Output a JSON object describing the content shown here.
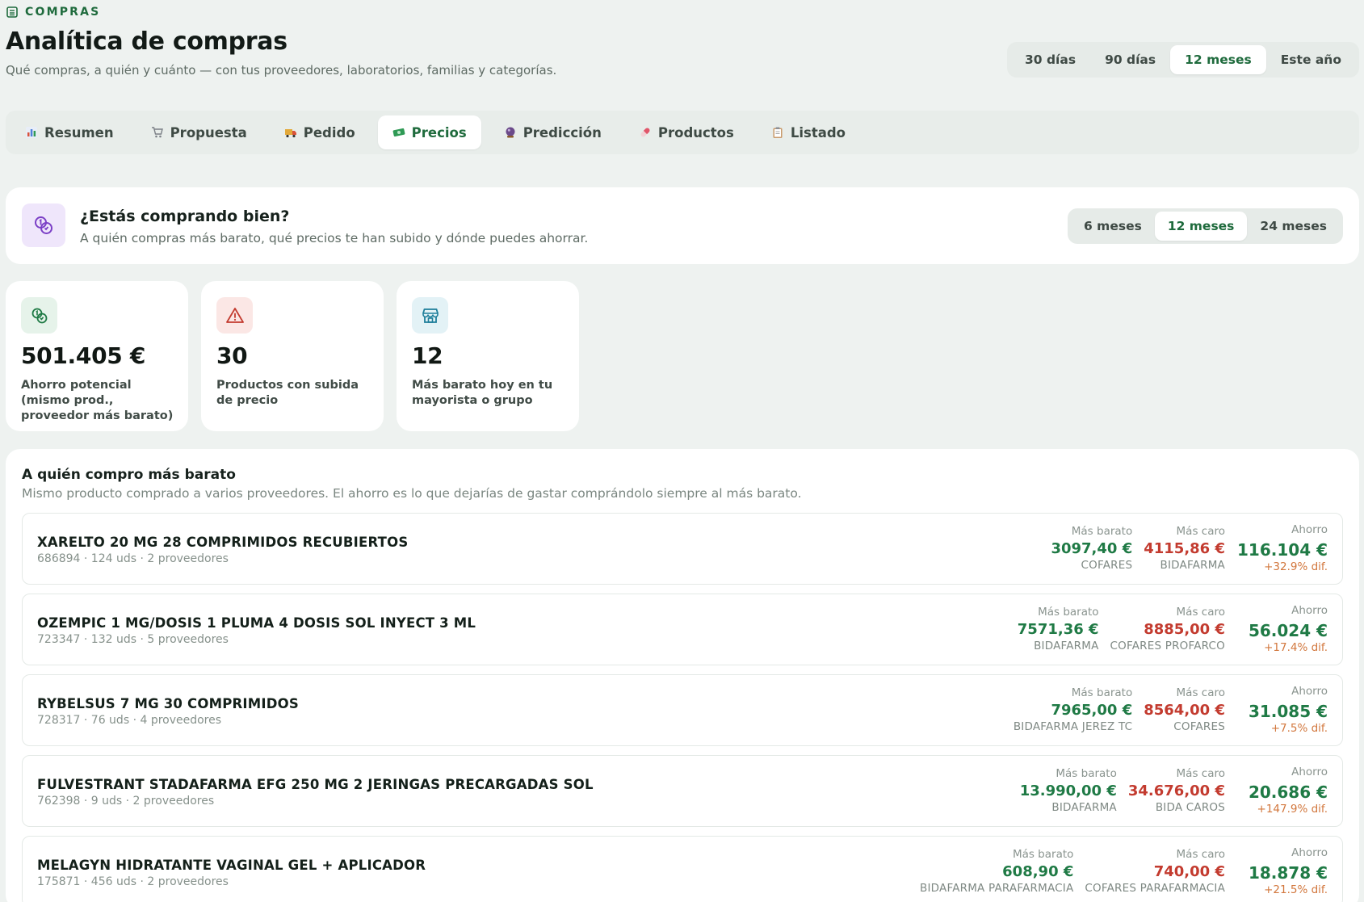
{
  "header": {
    "eyebrow": "COMPRAS",
    "title": "Analítica de compras",
    "subtitle": "Qué compras, a quién y cuánto — con tus proveedores, laboratorios, familias y categorías.",
    "periods": [
      "30 días",
      "90 días",
      "12 meses",
      "Este año"
    ],
    "active_period": "12 meses"
  },
  "tabs": [
    {
      "label": "Resumen",
      "icon": "bar-chart-icon",
      "color": "#4d7fd6"
    },
    {
      "label": "Propuesta",
      "icon": "cart-icon",
      "color": "#8a8f96"
    },
    {
      "label": "Pedido",
      "icon": "truck-icon",
      "color": "#d9533b"
    },
    {
      "label": "Precios",
      "icon": "money-icon",
      "color": "#2f9a55"
    },
    {
      "label": "Predicción",
      "icon": "crystal-ball-icon",
      "color": "#6b4a8a"
    },
    {
      "label": "Productos",
      "icon": "pill-icon",
      "color": "#e0566a"
    },
    {
      "label": "Listado",
      "icon": "clipboard-icon",
      "color": "#a0714a"
    }
  ],
  "active_tab": "Precios",
  "hero": {
    "title": "¿Estás comprando bien?",
    "subtitle": "A quién compras más barato, qué precios te han subido y dónde puedes ahorrar.",
    "icon": "coins-icon",
    "ranges": [
      "6 meses",
      "12 meses",
      "24 meses"
    ],
    "active_range": "12 meses"
  },
  "kpis": [
    {
      "value": "501.405 €",
      "label": "Ahorro potencial (mismo prod., proveedor más barato)",
      "icon": "coins-icon",
      "bg": "#e6f3ea",
      "color": "#1f7a45"
    },
    {
      "value": "30",
      "label": "Productos con subida de precio",
      "icon": "warning-icon",
      "bg": "#fbe7e5",
      "color": "#c33b2f"
    },
    {
      "value": "12",
      "label": "Más barato hoy en tu mayorista o grupo",
      "icon": "store-icon",
      "bg": "#e3f2f6",
      "color": "#1f7f9b"
    }
  ],
  "table": {
    "title": "A quién compro más barato",
    "subtitle": "Mismo producto comprado a varios proveedores. El ahorro es lo que dejarías de gastar comprándolo siempre al más barato.",
    "cheap_label": "Más barato",
    "expensive_label": "Más caro",
    "saving_label": "Ahorro",
    "rows": [
      {
        "name": "XARELTO 20 MG 28 COMPRIMIDOS RECUBIERTOS",
        "meta": "686894 · 124 uds · 2 proveedores",
        "cheap_price": "3097,40 €",
        "cheap_supplier": "COFARES",
        "exp_price": "4115,86 €",
        "exp_supplier": "BIDAFARMA",
        "saving": "116.104 €",
        "diff": "+32.9% dif."
      },
      {
        "name": "OZEMPIC 1 MG/DOSIS 1 PLUMA 4 DOSIS SOL INYECT 3 ML",
        "meta": "723347 · 132 uds · 5 proveedores",
        "cheap_price": "7571,36 €",
        "cheap_supplier": "BIDAFARMA",
        "exp_price": "8885,00 €",
        "exp_supplier": "COFARES PROFARCO",
        "saving": "56.024 €",
        "diff": "+17.4% dif."
      },
      {
        "name": "RYBELSUS 7 MG 30 COMPRIMIDOS",
        "meta": "728317 · 76 uds · 4 proveedores",
        "cheap_price": "7965,00 €",
        "cheap_supplier": "BIDAFARMA JEREZ TC",
        "exp_price": "8564,00 €",
        "exp_supplier": "COFARES",
        "saving": "31.085 €",
        "diff": "+7.5% dif."
      },
      {
        "name": "FULVESTRANT STADAFARMA EFG 250 MG 2 JERINGAS PRECARGADAS SOL",
        "meta": "762398 · 9 uds · 2 proveedores",
        "cheap_price": "13.990,00 €",
        "cheap_supplier": "BIDAFARMA",
        "exp_price": "34.676,00 €",
        "exp_supplier": "BIDA CAROS",
        "saving": "20.686 €",
        "diff": "+147.9% dif."
      },
      {
        "name": "MELAGYN HIDRATANTE VAGINAL GEL + APLICADOR",
        "meta": "175871 · 456 uds · 2 proveedores",
        "cheap_price": "608,90 €",
        "cheap_supplier": "BIDAFARMA PARAFARMACIA",
        "exp_price": "740,00 €",
        "exp_supplier": "COFARES PARAFARMACIA",
        "saving": "18.878 €",
        "diff": "+21.5% dif."
      }
    ]
  }
}
